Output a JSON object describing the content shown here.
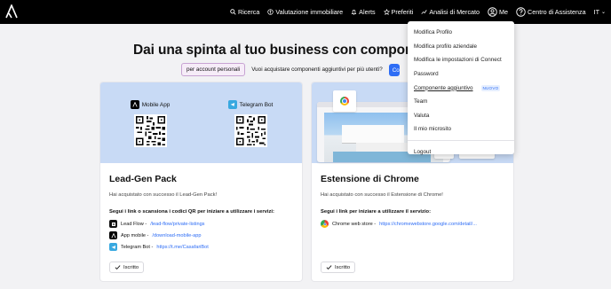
{
  "nav": {
    "items": [
      {
        "label": "Ricerca",
        "icon": "search-icon"
      },
      {
        "label": "Valutazione immobiliare",
        "icon": "valuation-icon"
      },
      {
        "label": "Alerts",
        "icon": "bell-icon"
      },
      {
        "label": "Preferiti",
        "icon": "star-icon"
      },
      {
        "label": "Analisi di Mercato",
        "icon": "chart-icon"
      },
      {
        "label": "Me",
        "icon": "user-icon"
      },
      {
        "label": "Centro di Assistenza",
        "icon": "help-icon"
      }
    ],
    "language": "IT"
  },
  "hero": {
    "title": "Dai una spinta al tuo business con componenti agg",
    "toggle_personal": "per account personali",
    "question": "Vuoi acquistare componenti aggiuntivi per più utenti?",
    "cta": "Co"
  },
  "menu": {
    "items": [
      {
        "label": "Modifica Profilo"
      },
      {
        "label": "Modifica profilo aziendale"
      },
      {
        "label": "Modifica le impostazioni di Connect"
      },
      {
        "label": "Password"
      },
      {
        "label": "Componente aggiuntivo",
        "badge": "NUOVO"
      },
      {
        "label": "Team"
      },
      {
        "label": "Valuta"
      },
      {
        "label": "Il mio microsito"
      }
    ],
    "logout": "Logout"
  },
  "cards": {
    "leadgen": {
      "qr_left_label": "Mobile App",
      "qr_right_label": "Telegram Bot",
      "title": "Lead-Gen Pack",
      "subtitle": "Hai acquistato con successo il Lead-Gen Pack!",
      "instruction": "Segui i link o scansiona i codici QR per iniziare a utilizzare i servizi:",
      "links": [
        {
          "label": "Lead Flow - ",
          "url": "/lead-flow/private-listings"
        },
        {
          "label": "App mobile - ",
          "url": "/download-mobile-app"
        },
        {
          "label": "Telegram Bot - ",
          "url": "https://t.me/CasafariBot"
        }
      ],
      "status": "Iscritto"
    },
    "chrome": {
      "title": "Estensione di Chrome",
      "subtitle": "Hai acquistato con successo il Estensione di Chrome!",
      "instruction": "Segui i link per iniziare a utilizzare il servizio:",
      "links": [
        {
          "label": "Chrome web store - ",
          "url": "https://chromewebstore.google.com/detail/..."
        }
      ],
      "status": "Iscritto"
    }
  },
  "colors": {
    "accent": "#2e6df5",
    "nav_bg": "#000000",
    "card_header_bg": "#c8daf5",
    "page_bg": "#f2f2f4",
    "toggle_bg": "#f6ecf8"
  }
}
